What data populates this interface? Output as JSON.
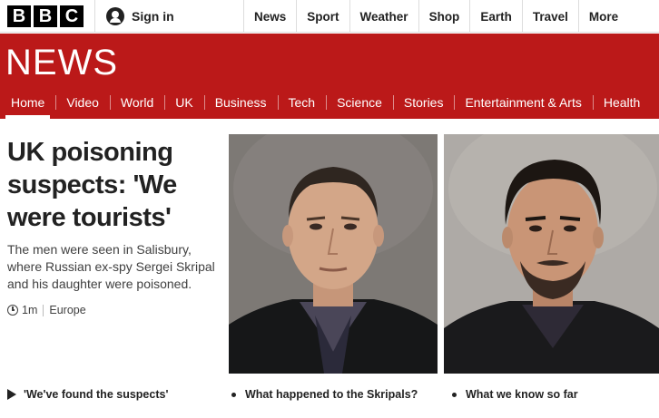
{
  "brand": {
    "logo_letters": [
      "B",
      "B",
      "C"
    ]
  },
  "account": {
    "signin_label": "Sign in"
  },
  "top_nav": [
    "News",
    "Sport",
    "Weather",
    "Shop",
    "Earth",
    "Travel",
    "More"
  ],
  "news_header": {
    "title": "NEWS"
  },
  "news_nav": {
    "items": [
      "Home",
      "Video",
      "World",
      "UK",
      "Business",
      "Tech",
      "Science",
      "Stories",
      "Entertainment & Arts",
      "Health"
    ],
    "active": "Home"
  },
  "story": {
    "headline": "UK poisoning suspects: 'We were tourists'",
    "summary": "The men were seen in Salisbury, where Russian ex-spy Sergei Skripal and his daughter were poisoned.",
    "time": "1m",
    "section": "Europe"
  },
  "related": {
    "video_link": "'We've found the suspects'",
    "link_2": "What happened to the Skripals?",
    "link_3": "What we know so far"
  },
  "colors": {
    "brand_red": "#bb1919"
  }
}
